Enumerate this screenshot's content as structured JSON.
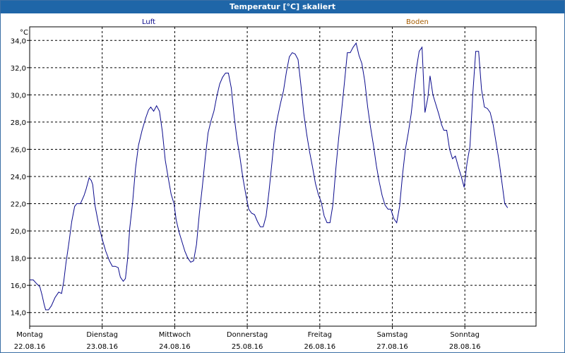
{
  "window": {
    "title": "Temperatur [°C] skaliert"
  },
  "chart_data": {
    "type": "line",
    "title": "Temperatur [°C] skaliert",
    "ylabel": "°C",
    "ylim": [
      13,
      35
    ],
    "y_ticks": [
      "14,0",
      "16,0",
      "18,0",
      "20,0",
      "22,0",
      "24,0",
      "26,0",
      "28,0",
      "30,0",
      "32,0",
      "34,0"
    ],
    "grid": true,
    "x_days": [
      {
        "day": "Montag",
        "date": "22.08.16"
      },
      {
        "day": "Dienstag",
        "date": "23.08.16"
      },
      {
        "day": "Mittwoch",
        "date": "24.08.16"
      },
      {
        "day": "Donnerstag",
        "date": "25.08.16"
      },
      {
        "day": "Freitag",
        "date": "26.08.16"
      },
      {
        "day": "Samstag",
        "date": "27.08.16"
      },
      {
        "day": "Sonntag",
        "date": "28.08.16"
      }
    ],
    "x_range_days": [
      0,
      7.07
    ],
    "legend": [
      {
        "label": "Luft",
        "color": "#0a0a8c"
      },
      {
        "label": "Boden",
        "color": "#a65c00"
      }
    ],
    "series": [
      {
        "name": "Luft",
        "color": "#0a0a8c",
        "points": [
          [
            0.0,
            16.4
          ],
          [
            0.05,
            16.4
          ],
          [
            0.1,
            16.1
          ],
          [
            0.14,
            15.9
          ],
          [
            0.17,
            15.3
          ],
          [
            0.2,
            14.6
          ],
          [
            0.22,
            14.2
          ],
          [
            0.26,
            14.2
          ],
          [
            0.3,
            14.5
          ],
          [
            0.35,
            15.1
          ],
          [
            0.4,
            15.5
          ],
          [
            0.44,
            15.4
          ],
          [
            0.47,
            16.3
          ],
          [
            0.5,
            17.6
          ],
          [
            0.54,
            19.1
          ],
          [
            0.58,
            20.7
          ],
          [
            0.62,
            21.8
          ],
          [
            0.65,
            22.0
          ],
          [
            0.7,
            22.0
          ],
          [
            0.75,
            22.6
          ],
          [
            0.78,
            23.1
          ],
          [
            0.82,
            23.9
          ],
          [
            0.85,
            23.7
          ],
          [
            0.87,
            23.4
          ],
          [
            0.9,
            21.9
          ],
          [
            0.95,
            20.5
          ],
          [
            1.0,
            19.4
          ],
          [
            1.05,
            18.5
          ],
          [
            1.1,
            17.8
          ],
          [
            1.14,
            17.4
          ],
          [
            1.18,
            17.4
          ],
          [
            1.22,
            17.3
          ],
          [
            1.25,
            16.6
          ],
          [
            1.29,
            16.3
          ],
          [
            1.32,
            16.5
          ],
          [
            1.35,
            17.9
          ],
          [
            1.38,
            20.2
          ],
          [
            1.42,
            22.1
          ],
          [
            1.46,
            24.6
          ],
          [
            1.5,
            26.3
          ],
          [
            1.55,
            27.4
          ],
          [
            1.6,
            28.3
          ],
          [
            1.64,
            28.9
          ],
          [
            1.67,
            29.1
          ],
          [
            1.71,
            28.8
          ],
          [
            1.75,
            29.2
          ],
          [
            1.79,
            28.8
          ],
          [
            1.83,
            27.3
          ],
          [
            1.87,
            25.2
          ],
          [
            1.91,
            23.9
          ],
          [
            1.95,
            22.7
          ],
          [
            1.99,
            22.0
          ],
          [
            2.02,
            20.8
          ],
          [
            2.06,
            19.9
          ],
          [
            2.1,
            19.2
          ],
          [
            2.14,
            18.5
          ],
          [
            2.18,
            18.0
          ],
          [
            2.22,
            17.7
          ],
          [
            2.26,
            17.8
          ],
          [
            2.3,
            19.0
          ],
          [
            2.34,
            21.3
          ],
          [
            2.38,
            23.2
          ],
          [
            2.42,
            25.3
          ],
          [
            2.46,
            27.2
          ],
          [
            2.5,
            28.1
          ],
          [
            2.54,
            28.8
          ],
          [
            2.58,
            29.9
          ],
          [
            2.62,
            30.8
          ],
          [
            2.66,
            31.3
          ],
          [
            2.7,
            31.6
          ],
          [
            2.74,
            31.6
          ],
          [
            2.78,
            30.5
          ],
          [
            2.82,
            28.4
          ],
          [
            2.86,
            26.7
          ],
          [
            2.9,
            25.4
          ],
          [
            2.94,
            23.9
          ],
          [
            2.98,
            22.7
          ],
          [
            3.02,
            21.6
          ],
          [
            3.06,
            21.3
          ],
          [
            3.1,
            21.2
          ],
          [
            3.14,
            20.7
          ],
          [
            3.18,
            20.3
          ],
          [
            3.22,
            20.3
          ],
          [
            3.26,
            21.1
          ],
          [
            3.3,
            22.9
          ],
          [
            3.34,
            25.0
          ],
          [
            3.38,
            27.2
          ],
          [
            3.42,
            28.4
          ],
          [
            3.46,
            29.4
          ],
          [
            3.5,
            30.3
          ],
          [
            3.54,
            31.7
          ],
          [
            3.58,
            32.8
          ],
          [
            3.62,
            33.1
          ],
          [
            3.66,
            33.0
          ],
          [
            3.7,
            32.6
          ],
          [
            3.74,
            30.7
          ],
          [
            3.78,
            28.6
          ],
          [
            3.82,
            27.1
          ],
          [
            3.86,
            25.8
          ],
          [
            3.9,
            24.7
          ],
          [
            3.94,
            23.5
          ],
          [
            3.98,
            22.7
          ],
          [
            4.02,
            22.1
          ],
          [
            4.06,
            21.1
          ],
          [
            4.1,
            20.6
          ],
          [
            4.14,
            20.6
          ],
          [
            4.18,
            21.9
          ],
          [
            4.22,
            24.5
          ],
          [
            4.26,
            26.8
          ],
          [
            4.3,
            28.8
          ],
          [
            4.34,
            30.9
          ],
          [
            4.38,
            33.1
          ],
          [
            4.42,
            33.1
          ],
          [
            4.46,
            33.5
          ],
          [
            4.5,
            33.8
          ],
          [
            4.54,
            32.9
          ],
          [
            4.58,
            32.3
          ],
          [
            4.62,
            31.0
          ],
          [
            4.66,
            29.1
          ],
          [
            4.7,
            27.6
          ],
          [
            4.74,
            26.3
          ],
          [
            4.78,
            24.8
          ],
          [
            4.82,
            23.6
          ],
          [
            4.86,
            22.6
          ],
          [
            4.9,
            21.9
          ],
          [
            4.94,
            21.6
          ],
          [
            4.98,
            21.6
          ],
          [
            5.02,
            20.9
          ],
          [
            5.06,
            20.6
          ],
          [
            5.1,
            21.8
          ],
          [
            5.14,
            24.1
          ],
          [
            5.18,
            26.0
          ],
          [
            5.22,
            27.2
          ],
          [
            5.26,
            28.6
          ],
          [
            5.3,
            30.5
          ],
          [
            5.34,
            32.2
          ],
          [
            5.37,
            33.2
          ],
          [
            5.41,
            33.5
          ],
          [
            5.45,
            28.7
          ],
          [
            5.49,
            29.8
          ],
          [
            5.52,
            31.4
          ],
          [
            5.56,
            30.0
          ],
          [
            5.6,
            29.3
          ],
          [
            5.64,
            28.6
          ],
          [
            5.68,
            27.8
          ],
          [
            5.71,
            27.4
          ],
          [
            5.75,
            27.4
          ],
          [
            5.79,
            26.0
          ],
          [
            5.83,
            25.3
          ],
          [
            5.87,
            25.5
          ],
          [
            5.91,
            24.7
          ],
          [
            5.95,
            24.0
          ],
          [
            5.99,
            23.2
          ],
          [
            6.03,
            25.0
          ],
          [
            6.07,
            26.2
          ],
          [
            6.11,
            30.1
          ],
          [
            6.15,
            33.2
          ],
          [
            6.19,
            33.2
          ],
          [
            6.23,
            30.4
          ],
          [
            6.27,
            29.1
          ],
          [
            6.31,
            29.0
          ],
          [
            6.35,
            28.7
          ],
          [
            6.39,
            27.8
          ],
          [
            6.43,
            26.5
          ],
          [
            6.47,
            25.2
          ],
          [
            6.51,
            23.6
          ],
          [
            6.55,
            22.0
          ],
          [
            6.59,
            21.7
          ]
        ]
      }
    ]
  }
}
